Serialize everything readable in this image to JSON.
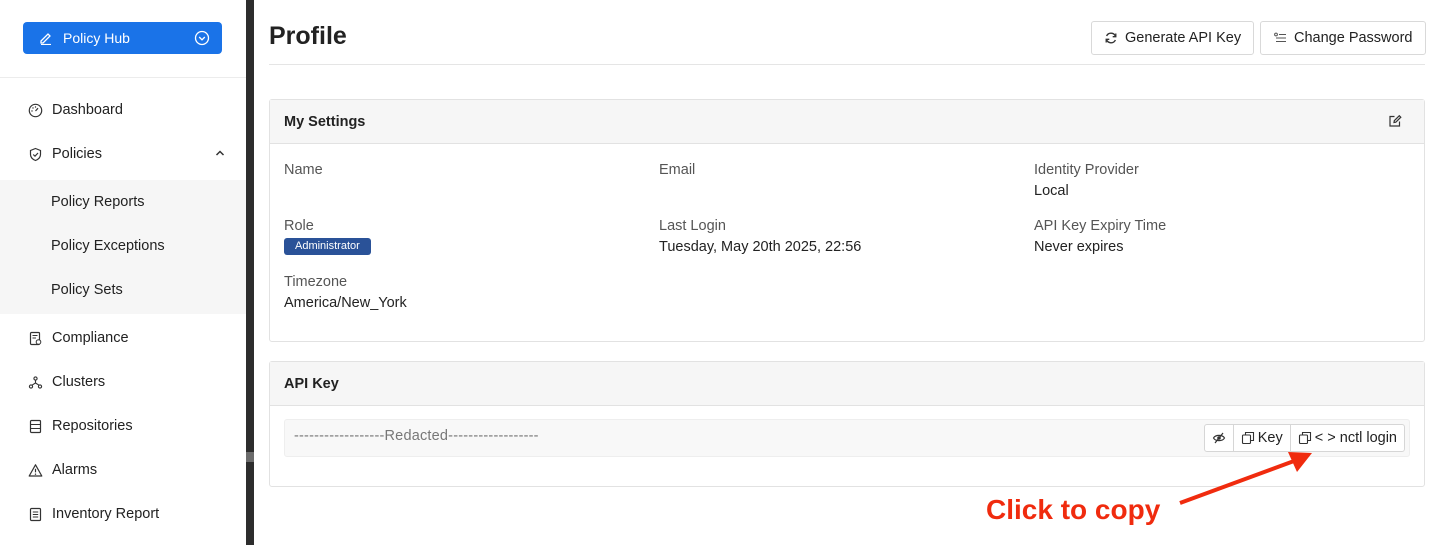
{
  "sidebar": {
    "hub_label": "Policy Hub",
    "items": [
      {
        "label": "Dashboard",
        "icon": "gauge-icon"
      },
      {
        "label": "Policies",
        "icon": "shield-check-icon"
      },
      {
        "label": "Compliance",
        "icon": "compliance-doc-icon"
      },
      {
        "label": "Clusters",
        "icon": "cluster-icon"
      },
      {
        "label": "Repositories",
        "icon": "repository-icon"
      },
      {
        "label": "Alarms",
        "icon": "warning-triangle-icon"
      },
      {
        "label": "Inventory Report",
        "icon": "list-doc-icon"
      }
    ],
    "sub_items": [
      {
        "label": "Policy Reports"
      },
      {
        "label": "Policy Exceptions"
      },
      {
        "label": "Policy Sets"
      }
    ]
  },
  "header": {
    "title": "Profile",
    "generate_label": "Generate API Key",
    "change_password_label": "Change Password"
  },
  "settings": {
    "title": "My Settings",
    "name_label": "Name",
    "name_value": "",
    "email_label": "Email",
    "email_value": "",
    "idp_label": "Identity Provider",
    "idp_value": "Local",
    "role_label": "Role",
    "role_value": "Administrator",
    "last_login_label": "Last Login",
    "last_login_value": "Tuesday, May 20th 2025, 22:56",
    "expiry_label": "API Key Expiry Time",
    "expiry_value": "Never expires",
    "timezone_label": "Timezone",
    "timezone_value": "America/New_York"
  },
  "api_key": {
    "title": "API Key",
    "value": "------------------Redacted------------------",
    "key_label": "Key",
    "login_label": "< > nctl login"
  },
  "annotation": {
    "text": "Click to copy"
  },
  "colors": {
    "primary": "#1a73e8",
    "badge": "#2a5298",
    "annotation": "#f02b0e"
  }
}
